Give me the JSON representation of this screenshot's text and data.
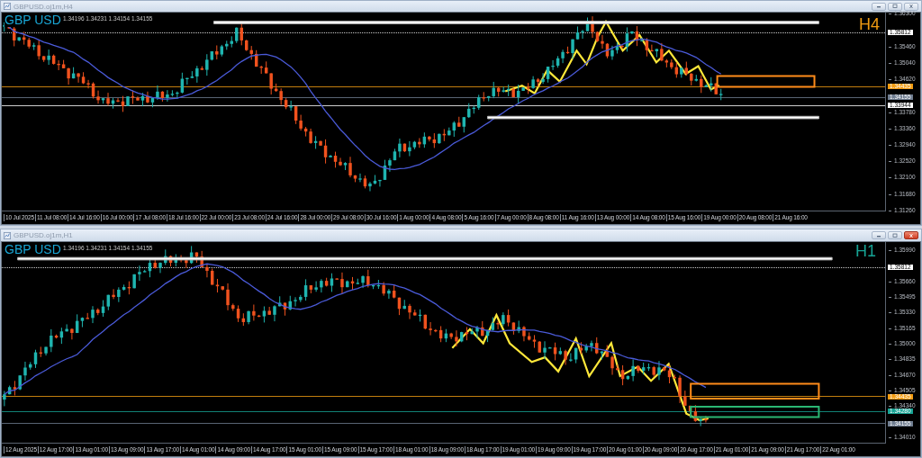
{
  "panels": [
    {
      "title": "GBPUSD.oj1m,H4",
      "symbol": "GBP USD",
      "info": "1.34196 1.34231 1.34154 1.34155",
      "timeframe": "H4",
      "ticks": [
        "1.36300",
        "1.35460",
        "1.35040",
        "1.34620",
        "1.33780",
        "1.33360",
        "1.32940",
        "1.32520",
        "1.32100",
        "1.31680",
        "1.31260"
      ],
      "tags": [
        {
          "price": "1.35812",
          "color": "#ffffff",
          "dotted": true
        },
        {
          "price": "1.34435",
          "color": "#f39c12",
          "dotted": false
        },
        {
          "price": "1.34155",
          "color": "#6f7d90",
          "dotted": false
        },
        {
          "price": "1.33944",
          "color": "#ffffff",
          "dotted": false
        }
      ],
      "times": [
        "10 Jul 2025",
        "11 Jul 08:00",
        "14 Jul 16:00",
        "16 Jul 00:00",
        "17 Jul 08:00",
        "18 Jul 16:00",
        "22 Jul 00:00",
        "23 Jul 08:00",
        "24 Jul 16:00",
        "28 Jul 00:00",
        "29 Jul 08:00",
        "30 Jul 16:00",
        "1 Aug 00:00",
        "4 Aug 08:00",
        "5 Aug 16:00",
        "7 Aug 00:00",
        "8 Aug 08:00",
        "11 Aug 16:00",
        "13 Aug 00:00",
        "14 Aug 08:00",
        "15 Aug 16:00",
        "19 Aug 00:00",
        "20 Aug 08:00",
        "21 Aug 16:00"
      ]
    },
    {
      "title": "GBPUSD.oj1m,H1",
      "symbol": "GBP USD",
      "info": "1.34196 1.34231 1.34154 1.34155",
      "timeframe": "H1",
      "ticks": [
        "1.35990",
        "1.35660",
        "1.35495",
        "1.35330",
        "1.35165",
        "1.35000",
        "1.34835",
        "1.34670",
        "1.34505",
        "1.34340",
        "1.34010"
      ],
      "tags": [
        {
          "price": "1.35812",
          "color": "#ffffff",
          "dotted": true
        },
        {
          "price": "1.34435",
          "color": "#f39c12",
          "dotted": false
        },
        {
          "price": "1.34280",
          "color": "#16a394",
          "dotted": false
        },
        {
          "price": "1.34155",
          "color": "#6f7d90",
          "dotted": false
        }
      ],
      "times": [
        "12 Aug 2025",
        "12 Aug 17:00",
        "13 Aug 01:00",
        "13 Aug 09:00",
        "13 Aug 17:00",
        "14 Aug 01:00",
        "14 Aug 09:00",
        "14 Aug 17:00",
        "15 Aug 01:00",
        "15 Aug 09:00",
        "15 Aug 17:00",
        "18 Aug 01:00",
        "18 Aug 09:00",
        "18 Aug 17:00",
        "19 Aug 01:00",
        "19 Aug 09:00",
        "19 Aug 17:00",
        "20 Aug 01:00",
        "20 Aug 09:00",
        "20 Aug 17:00",
        "21 Aug 01:00",
        "21 Aug 09:00",
        "21 Aug 17:00",
        "22 Aug 01:00"
      ]
    }
  ]
}
